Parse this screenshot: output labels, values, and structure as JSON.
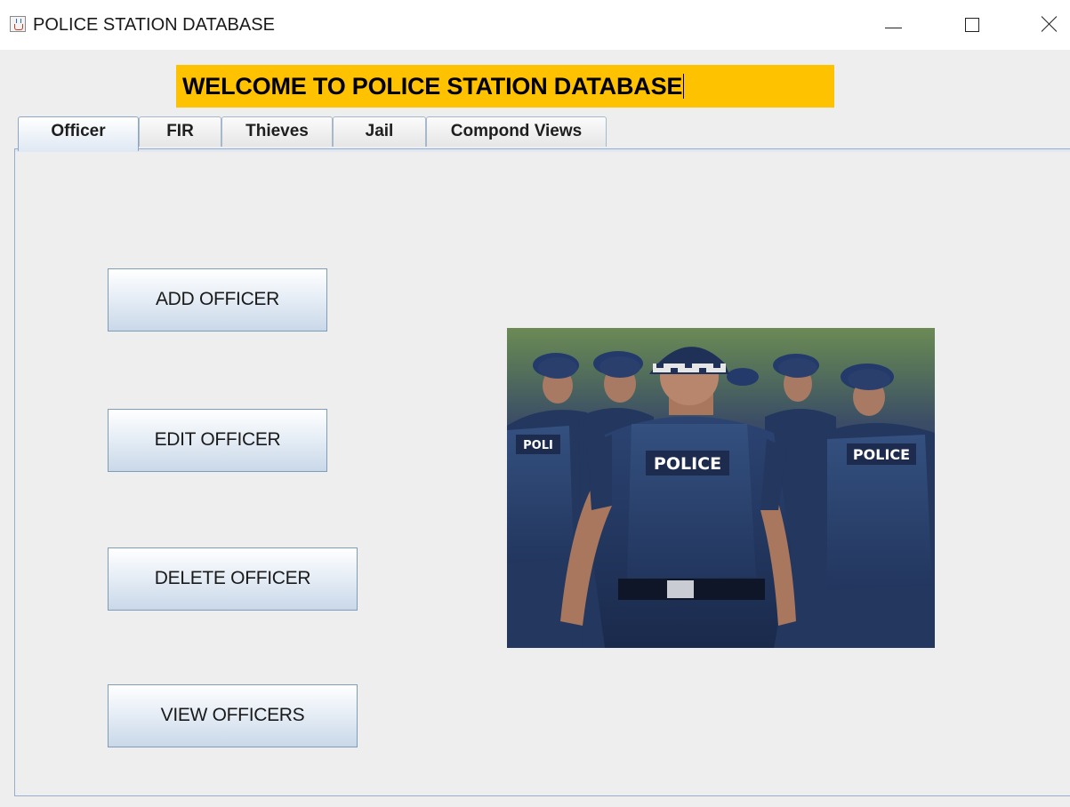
{
  "window": {
    "title": "POLICE STATION DATABASE",
    "controls": {
      "minimize": "minimize-icon",
      "maximize": "maximize-icon",
      "close": "close-icon"
    }
  },
  "banner": {
    "text": "WELCOME TO POLICE STATION DATABASE",
    "background": "#ffc200"
  },
  "tabs": [
    {
      "label": "Officer",
      "active": true
    },
    {
      "label": "FIR",
      "active": false
    },
    {
      "label": "Thieves",
      "active": false
    },
    {
      "label": "Jail",
      "active": false
    },
    {
      "label": "Compond Views",
      "active": false
    }
  ],
  "officer_panel": {
    "buttons": {
      "add": "ADD OFFICER",
      "edit": "EDIT OFFICER",
      "delete": "DELETE OFFICER",
      "view": "VIEW OFFICERS"
    },
    "photo": {
      "vest_labels": [
        "POLICE",
        "POLICE",
        "POLI"
      ]
    }
  },
  "colors": {
    "window_bg": "#eeeeee",
    "banner_bg": "#ffc200",
    "tab_border": "#8da6c3",
    "uniform": "#1f3157"
  }
}
